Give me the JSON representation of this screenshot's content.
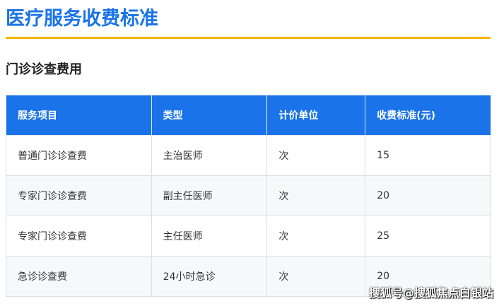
{
  "title": "医疗服务收费标准",
  "section": "门诊诊查费用",
  "table": {
    "headers": [
      "服务项目",
      "类型",
      "计价单位",
      "收费标准(元)"
    ],
    "rows": [
      [
        "普通门诊诊查费",
        "主治医师",
        "次",
        "15"
      ],
      [
        "专家门诊诊查费",
        "副主任医师",
        "次",
        "20"
      ],
      [
        "专家门诊诊查费",
        "主任医师",
        "次",
        "25"
      ],
      [
        "急诊诊查费",
        "24小时急诊",
        "次",
        "20"
      ]
    ]
  },
  "watermark": "搜狐号@搜狐焦点白银站",
  "colors": {
    "accent": "#1a73e8",
    "rule": "#f5b301"
  }
}
